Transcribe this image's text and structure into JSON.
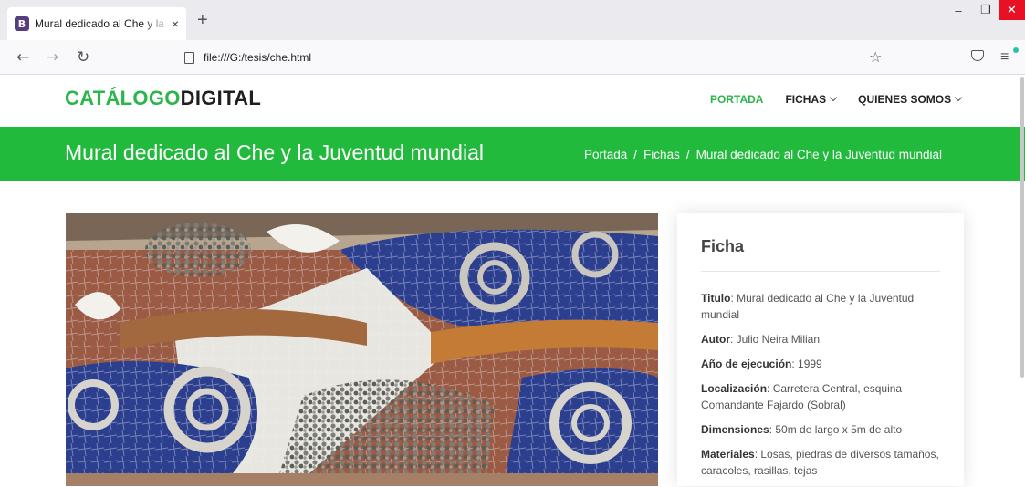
{
  "browser": {
    "tab_title": "Mural dedicado al Che y la Juventud mundial",
    "tab_icon_letter": "B",
    "tab_close": "×",
    "new_tab": "+",
    "url": "file:///G:/tesis/che.html"
  },
  "site": {
    "logo_part1": "CATÁLOGO",
    "logo_part2": "DIGITAL",
    "nav": [
      {
        "label": "PORTADA",
        "active": true
      },
      {
        "label": "FICHAS",
        "dropdown": true
      },
      {
        "label": "QUIENES SOMOS",
        "dropdown": true
      }
    ]
  },
  "banner": {
    "title": "Mural dedicado al Che y la Juventud mundial",
    "breadcrumb": [
      "Portada",
      "Fichas",
      "Mural dedicado al Che y la Juventud mundial"
    ],
    "separator": "/"
  },
  "ficha": {
    "title": "Ficha",
    "fields": [
      {
        "label": "Titulo",
        "value": ": Mural dedicado al Che y la Juventud mundial"
      },
      {
        "label": "Autor",
        "value": ": Julio Neira Milian"
      },
      {
        "label": "Año de ejecución",
        "value": ": 1999"
      },
      {
        "label": "Localización",
        "value": ": Carretera Central, esquina Comandante Fajardo (Sobral)"
      },
      {
        "label": "Dimensiones",
        "value": ": 50m de largo x 5m de alto"
      },
      {
        "label": "Materiales",
        "value": ": Losas, piedras de diversos tamaños, caracoles, rasillas, tejas"
      }
    ]
  },
  "colors": {
    "brand_green": "#22ba3d",
    "logo_green": "#2cb54a"
  }
}
